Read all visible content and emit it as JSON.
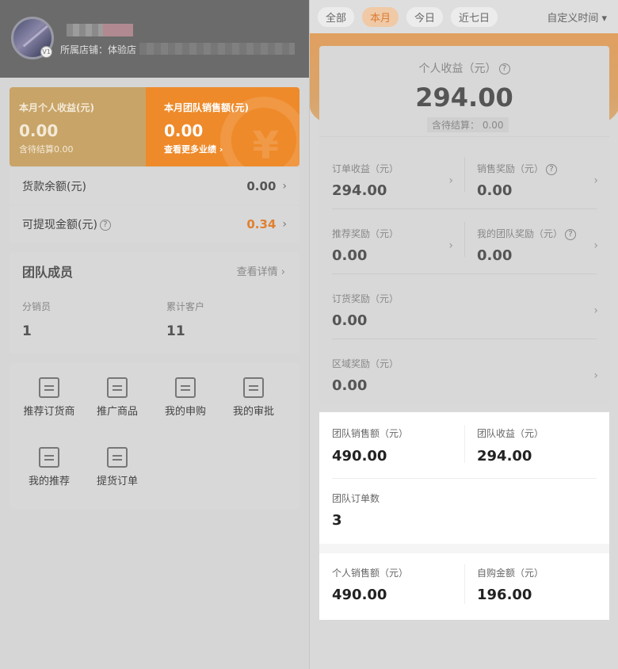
{
  "left": {
    "store_label": "所属店铺：体验店",
    "avatar_badge": "V1",
    "card_personal": {
      "title": "本月个人收益(元)",
      "value": "0.00",
      "sub": "含待结算0.00"
    },
    "card_team": {
      "title": "本月团队销售额(元)",
      "value": "0.00",
      "link": "查看更多业绩 ›"
    },
    "rows": [
      {
        "label": "货款余额(元)",
        "value": "0.00"
      },
      {
        "label": "可提现金额(元)",
        "value": "0.34",
        "value_color": "#e08030"
      }
    ],
    "team": {
      "title": "团队成员",
      "more": "查看详情",
      "stats": [
        {
          "label": "分销员",
          "value": "1"
        },
        {
          "label": "累计客户",
          "value": "11"
        }
      ]
    },
    "menu": [
      {
        "label": "推荐订货商",
        "icon": "box-icon"
      },
      {
        "label": "推广商品",
        "icon": "bag-icon"
      },
      {
        "label": "我的申购",
        "icon": "document-icon"
      },
      {
        "label": "我的审批",
        "icon": "stamp-icon"
      },
      {
        "label": "我的推荐",
        "icon": "bookmark-icon"
      },
      {
        "label": "提货订单",
        "icon": "list-icon"
      }
    ]
  },
  "right": {
    "tabs": [
      "全部",
      "本月",
      "今日",
      "近七日"
    ],
    "active_tab": "本月",
    "custom_time": "自定义时间",
    "summary": {
      "title": "个人收益（元）",
      "value": "294.00",
      "pending": "含待结算： 0.00"
    },
    "cells": [
      {
        "label": "订单收益（元）",
        "value": "294.00"
      },
      {
        "label": "销售奖励（元）",
        "value": "0.00"
      },
      {
        "label": "推荐奖励（元）",
        "value": "0.00"
      },
      {
        "label": "我的团队奖励（元）",
        "value": "0.00"
      },
      {
        "label": "订货奖励（元）",
        "value": "0.00"
      },
      {
        "label": "区域奖励（元）",
        "value": "0.00"
      }
    ],
    "team_stats": [
      {
        "label": "团队销售额（元）",
        "value": "490.00"
      },
      {
        "label": "团队收益（元）",
        "value": "294.00"
      },
      {
        "label": "团队订单数",
        "value": "3"
      }
    ],
    "personal_stats": [
      {
        "label": "个人销售额（元）",
        "value": "490.00"
      },
      {
        "label": "自购金额（元）",
        "value": "196.00"
      }
    ]
  }
}
